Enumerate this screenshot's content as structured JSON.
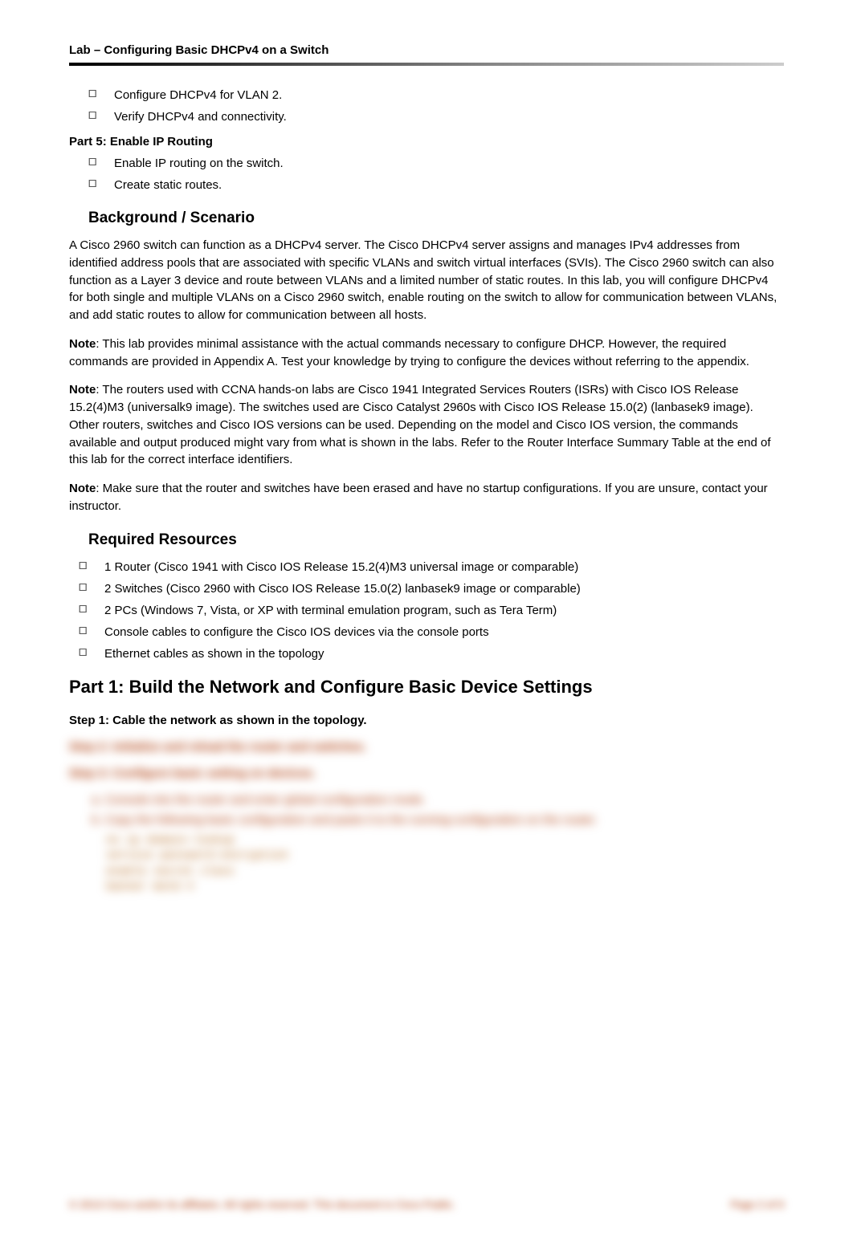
{
  "header": {
    "title": "Lab – Configuring Basic DHCPv4 on a Switch"
  },
  "top_bullets": [
    "Configure DHCPv4 for VLAN 2.",
    "Verify DHCPv4 and connectivity."
  ],
  "part5": {
    "title": "Part 5: Enable IP Routing",
    "bullets": [
      "Enable IP routing on the switch.",
      "Create static routes."
    ]
  },
  "background": {
    "title": "Background / Scenario",
    "paragraphs": [
      "A Cisco 2960 switch can function as a DHCPv4 server. The Cisco DHCPv4 server assigns and manages IPv4 addresses from identified address pools that are associated with specific VLANs and switch virtual interfaces (SVIs). The Cisco 2960 switch can also function as a Layer 3 device and route between VLANs and a limited number of static routes. In this lab, you will configure DHCPv4 for both single and multiple VLANs on a Cisco 2960 switch, enable routing on the switch to allow for communication between VLANs, and add static routes to allow for communication between all hosts."
    ],
    "note1_label": "Note",
    "note1_text": ": This lab provides minimal assistance with the actual commands necessary to configure DHCP. However, the required commands are provided in Appendix A. Test your knowledge by trying to configure the devices without referring to the appendix.",
    "note2_label": "Note",
    "note2_text": ": The routers used with CCNA hands-on labs are Cisco 1941 Integrated Services Routers (ISRs) with Cisco IOS Release 15.2(4)M3 (universalk9 image). The switches used are Cisco Catalyst 2960s with Cisco IOS Release 15.0(2) (lanbasek9 image). Other routers, switches and Cisco IOS versions can be used. Depending on the model and Cisco IOS version, the commands available and output produced might vary from what is shown in the labs. Refer to the Router Interface Summary Table at the end of this lab for the correct interface identifiers.",
    "note3_label": "Note",
    "note3_text": ": Make sure that the router and switches have been erased and have no startup configurations. If you are unsure, contact your instructor."
  },
  "resources": {
    "title": "Required Resources",
    "bullets": [
      "1 Router (Cisco 1941 with Cisco IOS Release 15.2(4)M3 universal image or comparable)",
      "2 Switches (Cisco 2960 with Cisco IOS Release 15.0(2) lanbasek9 image or comparable)",
      "2 PCs (Windows 7, Vista, or XP with terminal emulation program, such as Tera Term)",
      "Console cables to configure the Cisco IOS devices via the console ports",
      "Ethernet cables as shown in the topology"
    ]
  },
  "part1": {
    "title": "Part 1:   Build the Network and Configure Basic Device Settings",
    "step1": "Step 1:   Cable the network as shown in the topology."
  },
  "blurred": {
    "step2": "Step 2:   Initialize and reload the router and switches.",
    "step3": "Step 3:   Configure basic setting on devices.",
    "letter_a": "a.   Console into the router and enter global configuration mode.",
    "letter_b": "b.   Copy the following basic configuration and paste it to the running-configuration on the router.",
    "code_lines": [
      "no ip domain-lookup",
      "service password-encryption",
      "enable secret class",
      "banner motd #"
    ]
  },
  "footer": {
    "left": "© 2013 Cisco and/or its affiliates. All rights reserved. This document is Cisco Public.",
    "right": "Page 2 of 9"
  }
}
